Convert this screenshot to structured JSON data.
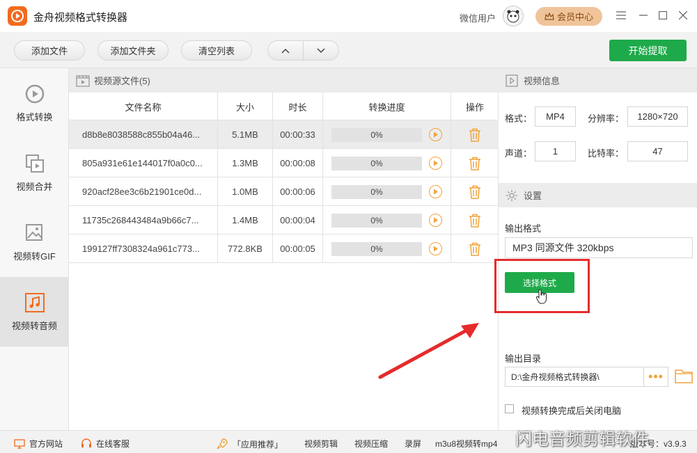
{
  "app": {
    "title": "金舟视频格式转换器",
    "user_label": "微信用户",
    "vip_label": "会员中心"
  },
  "toolbar": {
    "add_file": "添加文件",
    "add_folder": "添加文件夹",
    "clear_list": "清空列表",
    "start": "开始提取"
  },
  "sidebar": {
    "items": [
      {
        "label": "格式转换"
      },
      {
        "label": "视频合并"
      },
      {
        "label": "视频转GIF"
      },
      {
        "label": "视频转音频"
      }
    ]
  },
  "files": {
    "header": "视频源文件(5)",
    "columns": [
      "文件名称",
      "大小",
      "时长",
      "转换进度",
      "操作"
    ],
    "rows": [
      {
        "name": "d8b8e8038588c855b04a46...",
        "size": "5.1MB",
        "duration": "00:00:33",
        "progress": "0%"
      },
      {
        "name": "805a931e61e144017f0a0c0...",
        "size": "1.3MB",
        "duration": "00:00:08",
        "progress": "0%"
      },
      {
        "name": "920acf28ee3c6b21901ce0d...",
        "size": "1.0MB",
        "duration": "00:00:06",
        "progress": "0%"
      },
      {
        "name": "11735c268443484a9b66c7...",
        "size": "1.4MB",
        "duration": "00:00:04",
        "progress": "0%"
      },
      {
        "name": "199127ff7308324a961c773...",
        "size": "772.8KB",
        "duration": "00:00:05",
        "progress": "0%"
      }
    ]
  },
  "video_info": {
    "header": "视频信息",
    "format_label": "格式：",
    "format_value": "MP4",
    "resolution_label": "分辨率：",
    "resolution_value": "1280×720",
    "channel_label": "声道：",
    "channel_value": "1",
    "bitrate_label": "比特率：",
    "bitrate_value": "47"
  },
  "settings": {
    "header": "设置",
    "output_format_label": "输出格式",
    "output_format_value": "MP3 同源文件 320kbps",
    "choose_format": "选择格式",
    "output_dir_label": "输出目录",
    "output_dir_value": "D:\\金舟视频格式转换器\\",
    "dots": "•••",
    "shutdown_label": "视频转换完成后关闭电脑"
  },
  "statusbar": {
    "official_site": "官方网站",
    "online_service": "在线客服",
    "recommend": "「应用推荐」",
    "links": [
      "视频剪辑",
      "视频压缩",
      "录屏",
      "m3u8视频转mp4"
    ],
    "version": "版本号：v3.9.3"
  },
  "watermark": "闪电音频剪辑软件",
  "colors": {
    "accent_green": "#1eaa4a",
    "orange": "#f26b1d",
    "highlight_red": "#e52b2b"
  }
}
